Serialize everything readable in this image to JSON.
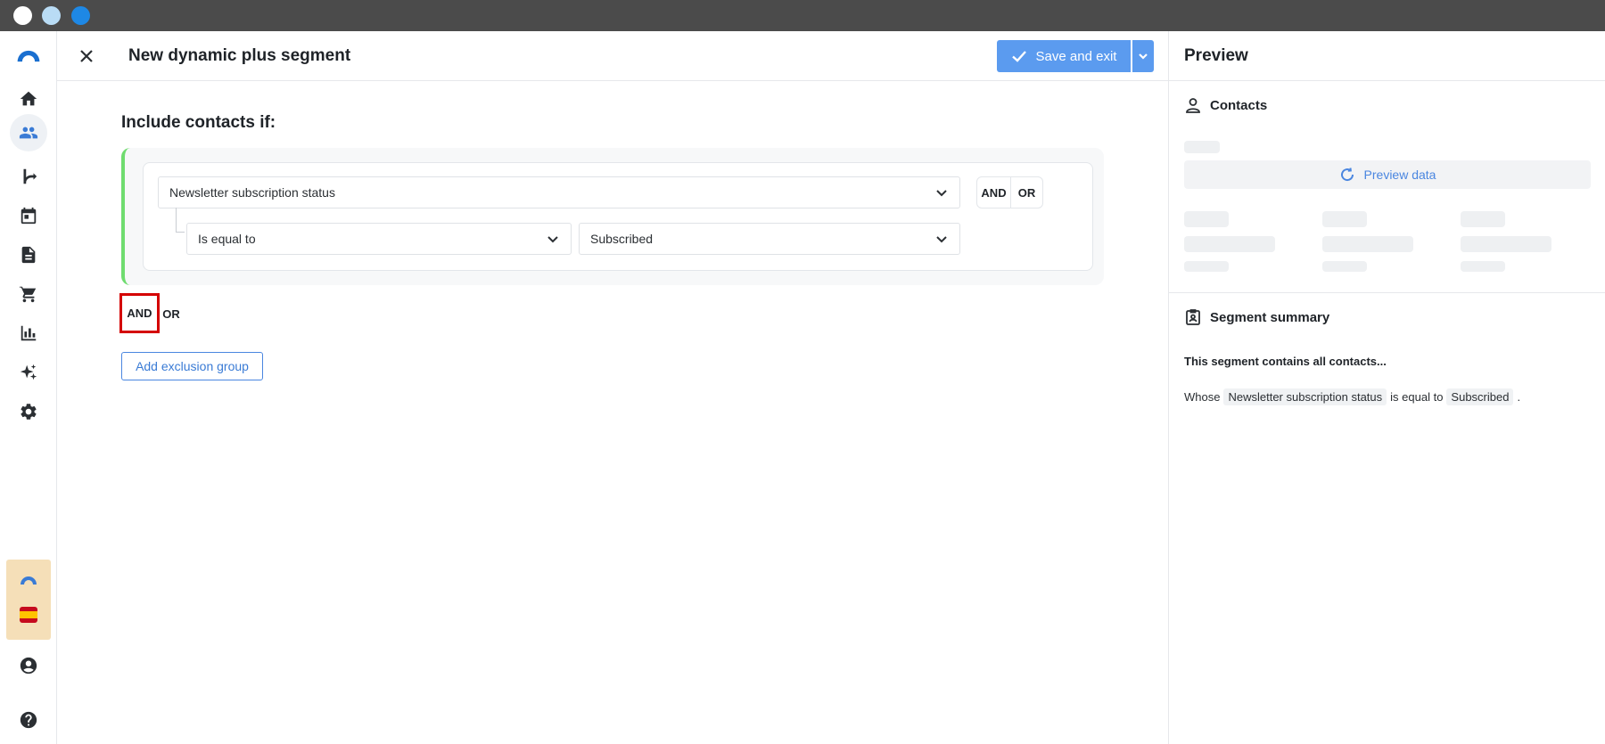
{
  "window": {
    "dot_colors": [
      "#ffffff",
      "#b9dcf5",
      "#1e88e5"
    ]
  },
  "nav": {
    "items": [
      {
        "icon": "home-icon"
      },
      {
        "icon": "contacts-icon",
        "active": true
      },
      {
        "icon": "automation-icon"
      },
      {
        "icon": "calendar-icon"
      },
      {
        "icon": "document-icon"
      },
      {
        "icon": "cart-icon"
      },
      {
        "icon": "bar-chart-icon"
      },
      {
        "icon": "sparkle-icon"
      },
      {
        "icon": "gear-icon"
      }
    ],
    "bottom": [
      "account-icon",
      "help-icon"
    ],
    "accent_color": "#3a7bd5"
  },
  "header": {
    "title": "New dynamic plus segment",
    "save_label": "Save and exit",
    "save_color": "#5b9bef"
  },
  "builder": {
    "include_title": "Include contacts if:",
    "group_accent": "#6fdc6f",
    "condition": {
      "field": "Newsletter subscription status",
      "operator": "Is equal to",
      "value": "Subscribed"
    },
    "inner_and": "AND",
    "inner_or": "OR",
    "outer_and": "AND",
    "outer_or": "OR",
    "exclusion_label": "Add exclusion group"
  },
  "preview": {
    "title": "Preview",
    "contacts_label": "Contacts",
    "preview_data_label": "Preview data",
    "summary_label": "Segment summary",
    "summary_lead": "This segment contains all contacts...",
    "summary": {
      "prefix": "Whose",
      "field": "Newsletter subscription status",
      "middle": "is equal to",
      "value": "Subscribed",
      "suffix": "."
    }
  }
}
